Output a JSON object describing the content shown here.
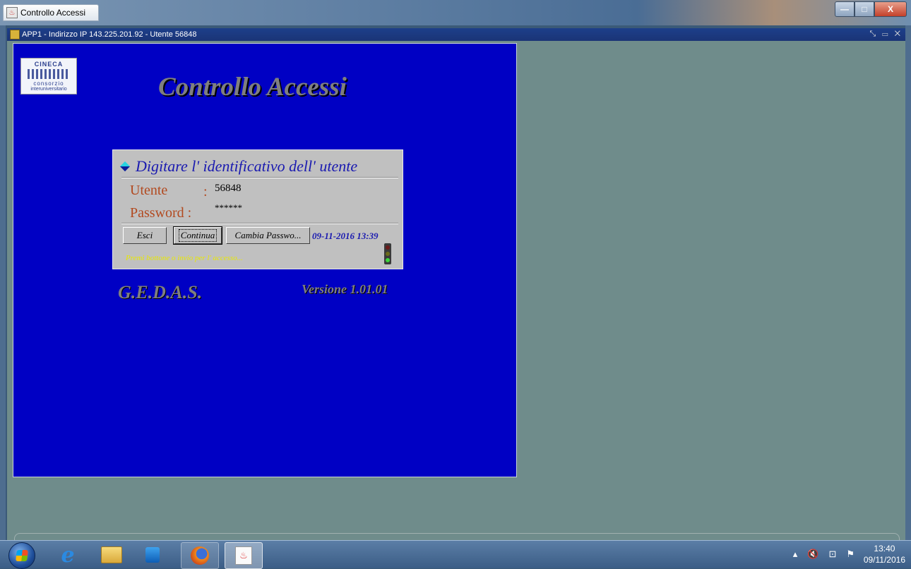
{
  "window": {
    "title": "Controllo Accessi",
    "controls": {
      "minimize": "—",
      "maximize": "□",
      "close": "X"
    }
  },
  "inner_frame": {
    "title": "APP1 - Indirizzo IP 143.225.201.92 - Utente 56848",
    "controls": "⤡ ▭ ✕"
  },
  "app": {
    "logo": {
      "line1": "CINECA",
      "line2": "consorzio",
      "line3": "interuniversitario"
    },
    "title": "Controllo Accessi",
    "login": {
      "heading": "Digitare l' identificativo dell' utente",
      "user_label": "Utente",
      "colon": ":",
      "user_value": "56848",
      "password_label": "Password :",
      "password_value": "******",
      "buttons": {
        "exit": "Esci",
        "continue": "Continua",
        "change_password": "Cambia Passwo..."
      },
      "datetime": "09-11-2016 13:39",
      "status_message": "Premi bottone o invio per l' accesso..."
    },
    "product": "G.E.D.A.S.",
    "version": "Versione 1.01.01"
  },
  "taskbar": {
    "icons": [
      "start-icon",
      "internet-explorer-icon",
      "file-explorer-icon",
      "media-player-icon",
      "firefox-icon",
      "java-icon"
    ],
    "tray": {
      "arrow": "▴",
      "volume": "🔇",
      "network": "⊡",
      "flag": "⚑"
    },
    "clock_time": "13:40",
    "clock_date": "09/11/2016"
  },
  "colors": {
    "panel_blue": "#0000c4",
    "desktop_gray": "#6f8c8b",
    "label_orange": "#b24a20",
    "heading_blue": "#1a1ab0",
    "status_yellow": "#e8e800"
  }
}
